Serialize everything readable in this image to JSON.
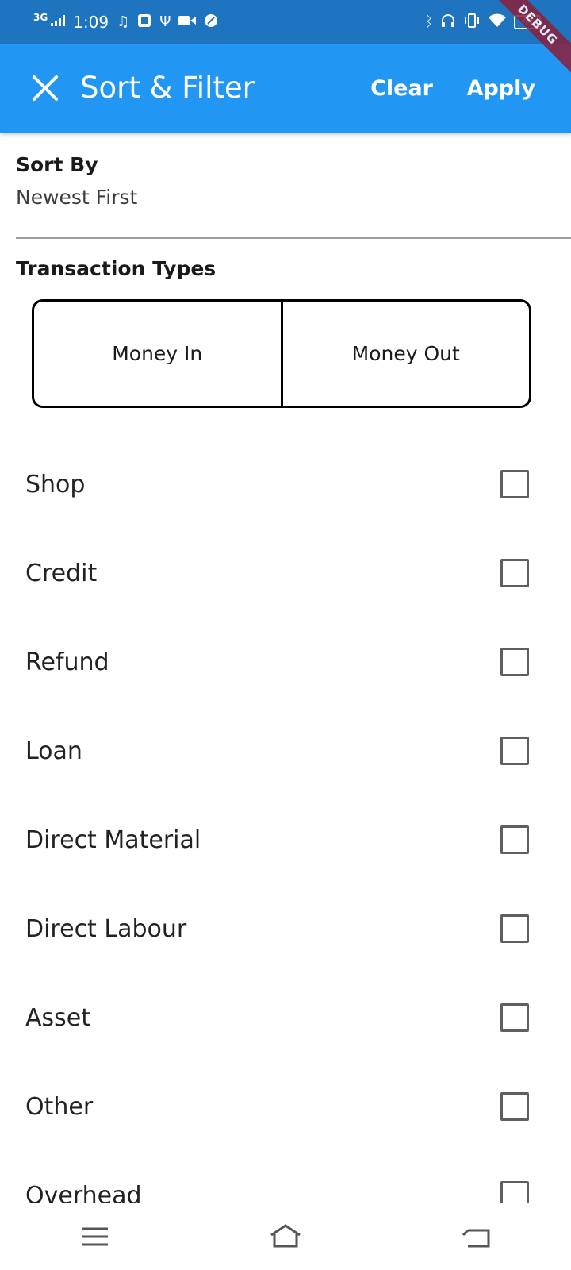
{
  "status_bar": {
    "network": "3G",
    "time": "1:09",
    "left_icons": [
      "music-note-icon",
      "notification-icon",
      "usb-icon",
      "video-icon",
      "leaf-icon"
    ],
    "right_icons": [
      "bluetooth-icon",
      "headphones-icon",
      "vibrate-icon",
      "wifi-icon"
    ],
    "battery": "69"
  },
  "debug_banner": "DEBUG",
  "app_bar": {
    "title": "Sort & Filter",
    "clear_label": "Clear",
    "apply_label": "Apply"
  },
  "sort": {
    "label": "Sort By",
    "value": "Newest First"
  },
  "transaction_types": {
    "label": "Transaction Types",
    "options": [
      "Money In",
      "Money Out"
    ]
  },
  "categories": [
    {
      "label": "Shop",
      "checked": false
    },
    {
      "label": "Credit",
      "checked": false
    },
    {
      "label": "Refund",
      "checked": false
    },
    {
      "label": "Loan",
      "checked": false
    },
    {
      "label": "Direct Material",
      "checked": false
    },
    {
      "label": "Direct Labour",
      "checked": false
    },
    {
      "label": "Asset",
      "checked": false
    },
    {
      "label": "Other",
      "checked": false
    },
    {
      "label": "Overhead",
      "checked": false
    }
  ],
  "nav_bar": [
    "menu-icon",
    "home-icon",
    "back-icon"
  ],
  "colors": {
    "status_bar": "#1f74c0",
    "app_bar": "#2196f3",
    "debug_ribbon": "#8b1f3b"
  }
}
